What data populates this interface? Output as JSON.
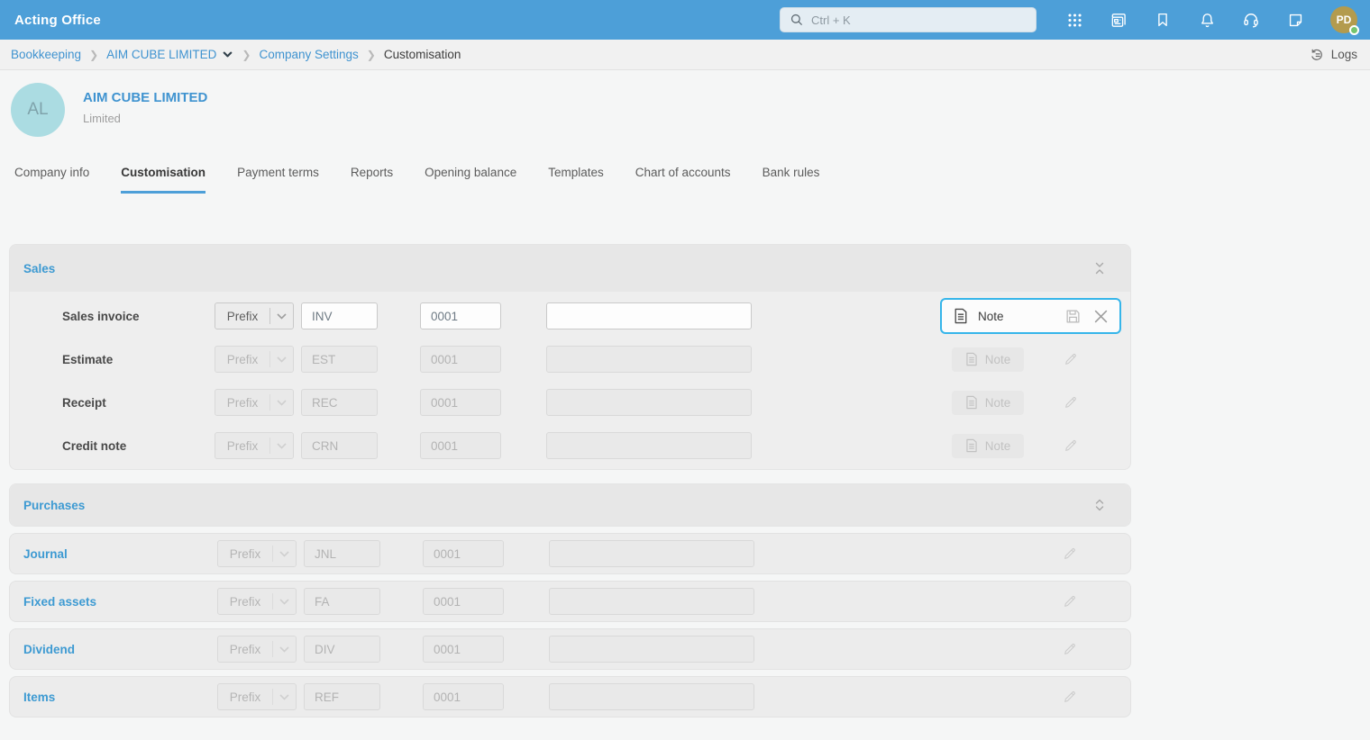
{
  "topbar": {
    "app_title": "Acting Office",
    "search_placeholder": "Ctrl + K",
    "avatar_initials": "PD"
  },
  "breadcrumb": {
    "items": [
      "Bookkeeping",
      "AIM CUBE LIMITED",
      "Company Settings",
      "Customisation"
    ],
    "logs_label": "Logs"
  },
  "company": {
    "initials": "AL",
    "name": "AIM CUBE LIMITED",
    "subtitle": "Limited"
  },
  "tabs": [
    "Company info",
    "Customisation",
    "Payment terms",
    "Reports",
    "Opening balance",
    "Templates",
    "Chart of accounts",
    "Bank rules"
  ],
  "active_tab": "Customisation",
  "sales": {
    "title": "Sales",
    "rows": [
      {
        "label": "Sales invoice",
        "prefix": "Prefix",
        "code": "INV",
        "number": "0001",
        "custom": "",
        "note": "Note",
        "state": "active"
      },
      {
        "label": "Estimate",
        "prefix": "Prefix",
        "code": "EST",
        "number": "0001",
        "custom": "",
        "note": "Note",
        "state": "disabled"
      },
      {
        "label": "Receipt",
        "prefix": "Prefix",
        "code": "REC",
        "number": "0001",
        "custom": "",
        "note": "Note",
        "state": "disabled"
      },
      {
        "label": "Credit note",
        "prefix": "Prefix",
        "code": "CRN",
        "number": "0001",
        "custom": "",
        "note": "Note",
        "state": "disabled"
      }
    ]
  },
  "purchases": {
    "title": "Purchases",
    "collapsed": true
  },
  "standalone_rows": [
    {
      "label": "Journal",
      "prefix": "Prefix",
      "code": "JNL",
      "number": "0001",
      "custom": ""
    },
    {
      "label": "Fixed assets",
      "prefix": "Prefix",
      "code": "FA",
      "number": "0001",
      "custom": ""
    },
    {
      "label": "Dividend",
      "prefix": "Prefix",
      "code": "DIV",
      "number": "0001",
      "custom": ""
    },
    {
      "label": "Items",
      "prefix": "Prefix",
      "code": "REF",
      "number": "0001",
      "custom": ""
    }
  ],
  "colors": {
    "topbar_blue": "#4d9fd8",
    "link_blue": "#3f93d0",
    "section_blue": "#3d9ad2",
    "active_border": "#35b5ea",
    "company_avatar": "#abdce2",
    "user_avatar": "#b39b4e",
    "status_online": "#74c56f"
  }
}
